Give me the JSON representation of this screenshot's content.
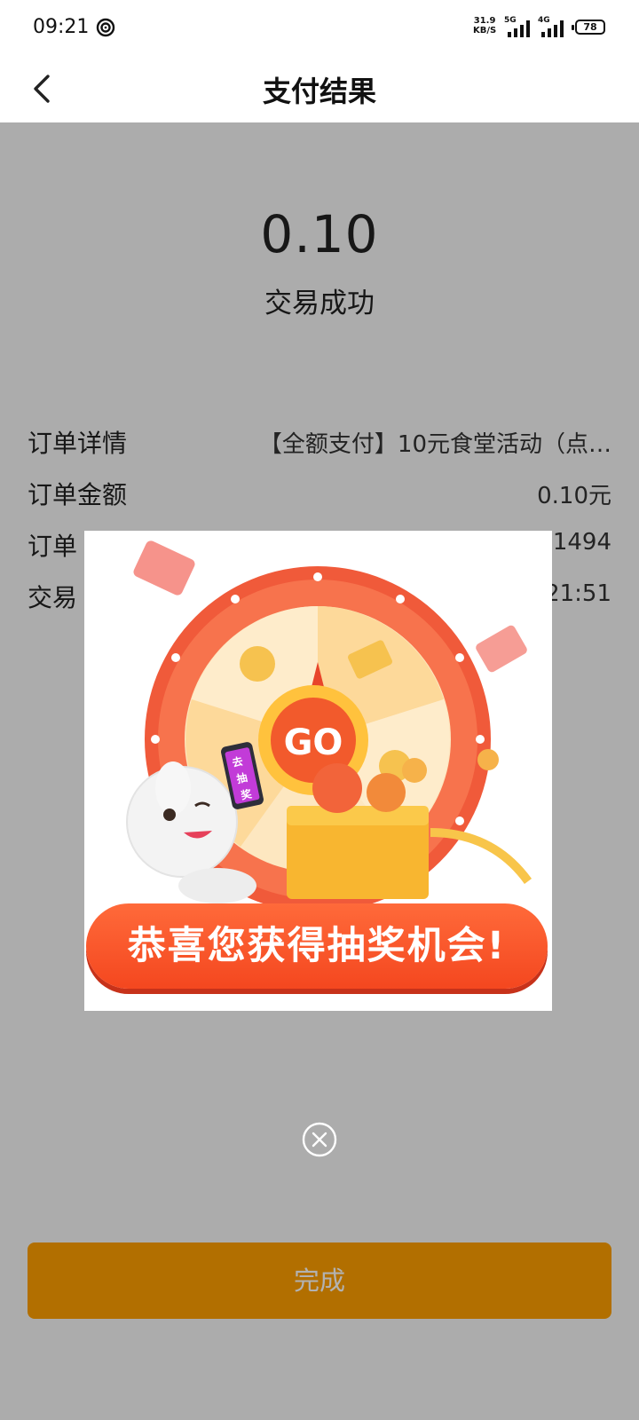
{
  "status_bar": {
    "time": "09:21",
    "net_speed_value": "31.9",
    "net_speed_unit": "KB/S",
    "sim1_label": "5G",
    "sim2_label": "4G",
    "battery_level": "78"
  },
  "header": {
    "title": "支付结果"
  },
  "result": {
    "amount": "0.10",
    "status": "交易成功"
  },
  "details": [
    {
      "label": "订单详情",
      "value": "【全额支付】10元食堂活动（点…"
    },
    {
      "label": "订单金额",
      "value": "0.10元"
    },
    {
      "label": "订单",
      "value": "1494"
    },
    {
      "label": "交易",
      "value": "21:51"
    }
  ],
  "popup": {
    "wheel_center_label": "GO",
    "phone_label": "去抽奖",
    "banner_text": "恭喜您获得抽奖机会!"
  },
  "done_button": "完成",
  "colors": {
    "accent": "#ffa000",
    "popup_red": "#f24a22",
    "background": "#f7f7f7"
  }
}
